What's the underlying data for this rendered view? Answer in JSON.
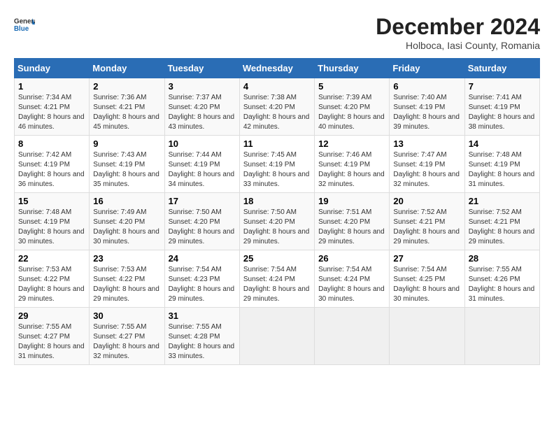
{
  "header": {
    "logo_general": "General",
    "logo_blue": "Blue",
    "month_year": "December 2024",
    "location": "Holboca, Iasi County, Romania"
  },
  "calendar": {
    "days_of_week": [
      "Sunday",
      "Monday",
      "Tuesday",
      "Wednesday",
      "Thursday",
      "Friday",
      "Saturday"
    ],
    "weeks": [
      [
        {
          "day": "",
          "empty": true
        },
        {
          "day": "",
          "empty": true
        },
        {
          "day": "",
          "empty": true
        },
        {
          "day": "",
          "empty": true
        },
        {
          "day": "5",
          "sunrise": "Sunrise: 7:39 AM",
          "sunset": "Sunset: 4:20 PM",
          "daylight": "Daylight: 8 hours and 40 minutes."
        },
        {
          "day": "6",
          "sunrise": "Sunrise: 7:40 AM",
          "sunset": "Sunset: 4:19 PM",
          "daylight": "Daylight: 8 hours and 39 minutes."
        },
        {
          "day": "7",
          "sunrise": "Sunrise: 7:41 AM",
          "sunset": "Sunset: 4:19 PM",
          "daylight": "Daylight: 8 hours and 38 minutes."
        }
      ],
      [
        {
          "day": "1",
          "sunrise": "Sunrise: 7:34 AM",
          "sunset": "Sunset: 4:21 PM",
          "daylight": "Daylight: 8 hours and 46 minutes."
        },
        {
          "day": "2",
          "sunrise": "Sunrise: 7:36 AM",
          "sunset": "Sunset: 4:21 PM",
          "daylight": "Daylight: 8 hours and 45 minutes."
        },
        {
          "day": "3",
          "sunrise": "Sunrise: 7:37 AM",
          "sunset": "Sunset: 4:20 PM",
          "daylight": "Daylight: 8 hours and 43 minutes."
        },
        {
          "day": "4",
          "sunrise": "Sunrise: 7:38 AM",
          "sunset": "Sunset: 4:20 PM",
          "daylight": "Daylight: 8 hours and 42 minutes."
        },
        {
          "day": "5",
          "sunrise": "Sunrise: 7:39 AM",
          "sunset": "Sunset: 4:20 PM",
          "daylight": "Daylight: 8 hours and 40 minutes."
        },
        {
          "day": "6",
          "sunrise": "Sunrise: 7:40 AM",
          "sunset": "Sunset: 4:19 PM",
          "daylight": "Daylight: 8 hours and 39 minutes."
        },
        {
          "day": "7",
          "sunrise": "Sunrise: 7:41 AM",
          "sunset": "Sunset: 4:19 PM",
          "daylight": "Daylight: 8 hours and 38 minutes."
        }
      ],
      [
        {
          "day": "8",
          "sunrise": "Sunrise: 7:42 AM",
          "sunset": "Sunset: 4:19 PM",
          "daylight": "Daylight: 8 hours and 36 minutes."
        },
        {
          "day": "9",
          "sunrise": "Sunrise: 7:43 AM",
          "sunset": "Sunset: 4:19 PM",
          "daylight": "Daylight: 8 hours and 35 minutes."
        },
        {
          "day": "10",
          "sunrise": "Sunrise: 7:44 AM",
          "sunset": "Sunset: 4:19 PM",
          "daylight": "Daylight: 8 hours and 34 minutes."
        },
        {
          "day": "11",
          "sunrise": "Sunrise: 7:45 AM",
          "sunset": "Sunset: 4:19 PM",
          "daylight": "Daylight: 8 hours and 33 minutes."
        },
        {
          "day": "12",
          "sunrise": "Sunrise: 7:46 AM",
          "sunset": "Sunset: 4:19 PM",
          "daylight": "Daylight: 8 hours and 32 minutes."
        },
        {
          "day": "13",
          "sunrise": "Sunrise: 7:47 AM",
          "sunset": "Sunset: 4:19 PM",
          "daylight": "Daylight: 8 hours and 32 minutes."
        },
        {
          "day": "14",
          "sunrise": "Sunrise: 7:48 AM",
          "sunset": "Sunset: 4:19 PM",
          "daylight": "Daylight: 8 hours and 31 minutes."
        }
      ],
      [
        {
          "day": "15",
          "sunrise": "Sunrise: 7:48 AM",
          "sunset": "Sunset: 4:19 PM",
          "daylight": "Daylight: 8 hours and 30 minutes."
        },
        {
          "day": "16",
          "sunrise": "Sunrise: 7:49 AM",
          "sunset": "Sunset: 4:20 PM",
          "daylight": "Daylight: 8 hours and 30 minutes."
        },
        {
          "day": "17",
          "sunrise": "Sunrise: 7:50 AM",
          "sunset": "Sunset: 4:20 PM",
          "daylight": "Daylight: 8 hours and 29 minutes."
        },
        {
          "day": "18",
          "sunrise": "Sunrise: 7:50 AM",
          "sunset": "Sunset: 4:20 PM",
          "daylight": "Daylight: 8 hours and 29 minutes."
        },
        {
          "day": "19",
          "sunrise": "Sunrise: 7:51 AM",
          "sunset": "Sunset: 4:20 PM",
          "daylight": "Daylight: 8 hours and 29 minutes."
        },
        {
          "day": "20",
          "sunrise": "Sunrise: 7:52 AM",
          "sunset": "Sunset: 4:21 PM",
          "daylight": "Daylight: 8 hours and 29 minutes."
        },
        {
          "day": "21",
          "sunrise": "Sunrise: 7:52 AM",
          "sunset": "Sunset: 4:21 PM",
          "daylight": "Daylight: 8 hours and 29 minutes."
        }
      ],
      [
        {
          "day": "22",
          "sunrise": "Sunrise: 7:53 AM",
          "sunset": "Sunset: 4:22 PM",
          "daylight": "Daylight: 8 hours and 29 minutes."
        },
        {
          "day": "23",
          "sunrise": "Sunrise: 7:53 AM",
          "sunset": "Sunset: 4:22 PM",
          "daylight": "Daylight: 8 hours and 29 minutes."
        },
        {
          "day": "24",
          "sunrise": "Sunrise: 7:54 AM",
          "sunset": "Sunset: 4:23 PM",
          "daylight": "Daylight: 8 hours and 29 minutes."
        },
        {
          "day": "25",
          "sunrise": "Sunrise: 7:54 AM",
          "sunset": "Sunset: 4:24 PM",
          "daylight": "Daylight: 8 hours and 29 minutes."
        },
        {
          "day": "26",
          "sunrise": "Sunrise: 7:54 AM",
          "sunset": "Sunset: 4:24 PM",
          "daylight": "Daylight: 8 hours and 30 minutes."
        },
        {
          "day": "27",
          "sunrise": "Sunrise: 7:54 AM",
          "sunset": "Sunset: 4:25 PM",
          "daylight": "Daylight: 8 hours and 30 minutes."
        },
        {
          "day": "28",
          "sunrise": "Sunrise: 7:55 AM",
          "sunset": "Sunset: 4:26 PM",
          "daylight": "Daylight: 8 hours and 31 minutes."
        }
      ],
      [
        {
          "day": "29",
          "sunrise": "Sunrise: 7:55 AM",
          "sunset": "Sunset: 4:27 PM",
          "daylight": "Daylight: 8 hours and 31 minutes."
        },
        {
          "day": "30",
          "sunrise": "Sunrise: 7:55 AM",
          "sunset": "Sunset: 4:27 PM",
          "daylight": "Daylight: 8 hours and 32 minutes."
        },
        {
          "day": "31",
          "sunrise": "Sunrise: 7:55 AM",
          "sunset": "Sunset: 4:28 PM",
          "daylight": "Daylight: 8 hours and 33 minutes."
        },
        {
          "day": "",
          "empty": true
        },
        {
          "day": "",
          "empty": true
        },
        {
          "day": "",
          "empty": true
        },
        {
          "day": "",
          "empty": true
        }
      ]
    ]
  }
}
